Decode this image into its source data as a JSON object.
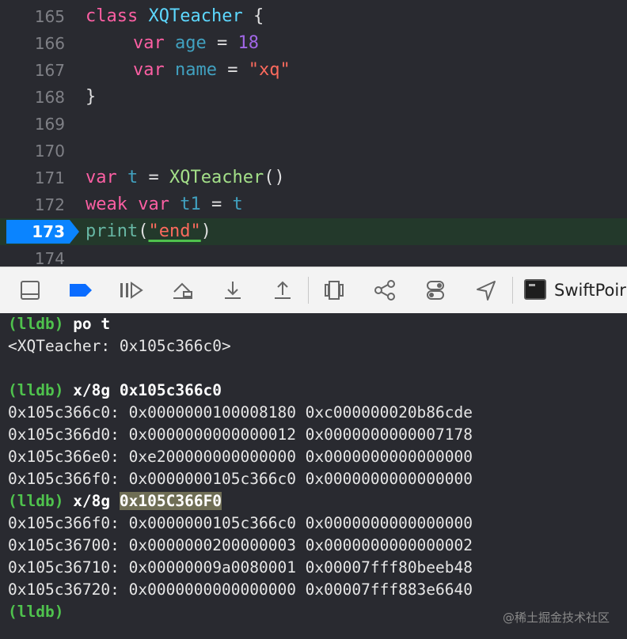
{
  "editor": {
    "lines": [
      {
        "num": "165"
      },
      {
        "num": "166"
      },
      {
        "num": "167"
      },
      {
        "num": "168"
      },
      {
        "num": "169"
      },
      {
        "num": "170"
      },
      {
        "num": "171"
      },
      {
        "num": "172"
      },
      {
        "num": "173"
      },
      {
        "num": "174"
      }
    ],
    "tokens": {
      "l165": [
        "class",
        " ",
        "XQTeacher",
        " {"
      ],
      "l166": [
        "var",
        " ",
        "age",
        " = ",
        "18"
      ],
      "l167": [
        "var",
        " ",
        "name",
        " = ",
        "\"xq\""
      ],
      "l168": [
        "}"
      ],
      "l171": [
        "var",
        " ",
        "t",
        " = ",
        "XQTeacher",
        "()"
      ],
      "l172": [
        "weak",
        " ",
        "var",
        " ",
        "t1",
        " = ",
        "t"
      ],
      "l173": [
        "print",
        "(",
        "\"end\"",
        ")"
      ]
    },
    "current_line": "173",
    "current_line_color": "#0a84ff"
  },
  "toolbar": {
    "icons": [
      "hide-debug-area-icon",
      "breakpoints-toggle-icon",
      "continue-icon",
      "step-over-icon",
      "step-into-icon",
      "step-out-icon",
      "view-hierarchy-icon",
      "memory-graph-icon",
      "environment-overrides-icon",
      "simulate-location-icon",
      "terminal-icon"
    ],
    "target_label": "SwiftPoir"
  },
  "console": {
    "lines": [
      {
        "prompt": "(lldb)",
        "cmd": " po t"
      },
      {
        "text": "<XQTeacher: 0x105c366c0>"
      },
      {
        "text": ""
      },
      {
        "prompt": "(lldb)",
        "cmd": " x/8g 0x105c366c0"
      },
      {
        "text": "0x105c366c0: 0x0000000100008180 0xc000000020b86cde"
      },
      {
        "text": "0x105c366d0: 0x0000000000000012 0x0000000000007178"
      },
      {
        "text": "0x105c366e0: 0xe200000000000000 0x0000000000000000"
      },
      {
        "text": "0x105c366f0: 0x0000000105c366c0 0x0000000000000000"
      },
      {
        "prompt": "(lldb)",
        "cmd": " x/8g ",
        "hl": "0x105C366F0"
      },
      {
        "text": "0x105c366f0: 0x0000000105c366c0 0x0000000000000000"
      },
      {
        "text": "0x105c36700: 0x0000000200000003 0x0000000000000002"
      },
      {
        "text": "0x105c36710: 0x00000009a0080001 0x00007fff80beeb48"
      },
      {
        "text": "0x105c36720: 0x0000000000000000 0x00007fff883e6640"
      },
      {
        "prompt": "(lldb)",
        "cmd": ""
      }
    ]
  },
  "watermark": "@稀土掘金技术社区"
}
